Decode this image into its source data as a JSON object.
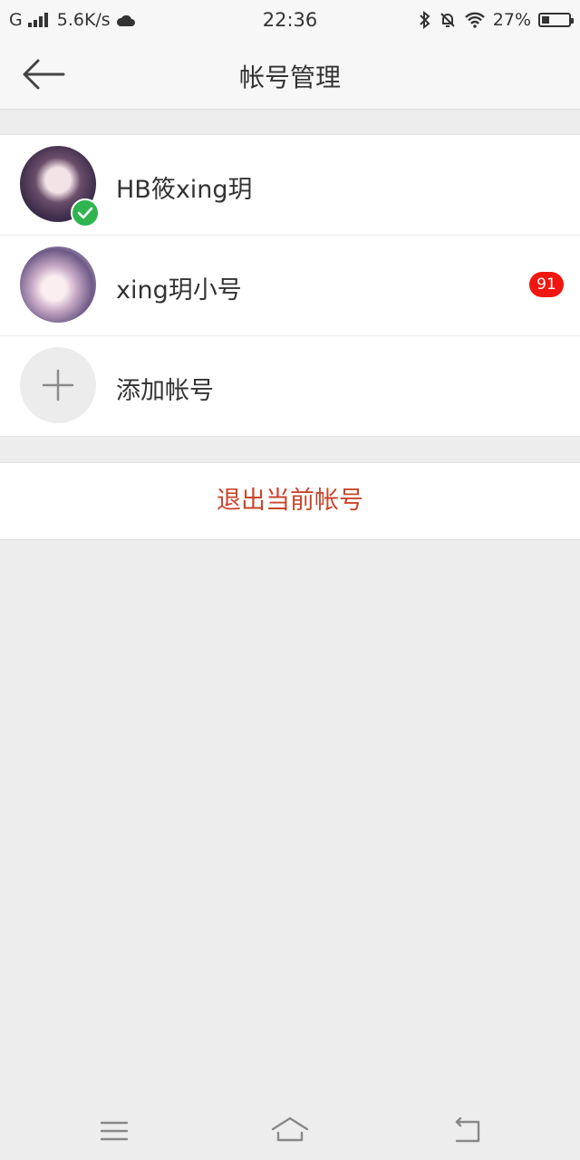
{
  "status_bar": {
    "network": "G",
    "speed": "5.6K/s",
    "time": "22:36",
    "battery": "27%",
    "battery_level": 0.27,
    "icons": [
      "signal-icon",
      "cloud-icon",
      "bluetooth-icon",
      "mute-bell-icon",
      "wifi-icon",
      "battery-icon"
    ]
  },
  "header": {
    "title": "帐号管理",
    "back_icon": "back-arrow-icon"
  },
  "accounts": [
    {
      "name": "HB筱xing玥",
      "active": true,
      "badge": ""
    },
    {
      "name": "xing玥小号",
      "active": false,
      "badge": "91"
    }
  ],
  "add_account_label": "添加帐号",
  "logout_label": "退出当前帐号",
  "colors": {
    "accent_red": "#c8462c",
    "badge_red": "#f1160f",
    "check_green": "#2fb44f",
    "background": "#ededed"
  },
  "system_nav": [
    "menu-icon",
    "home-icon",
    "back-icon"
  ]
}
